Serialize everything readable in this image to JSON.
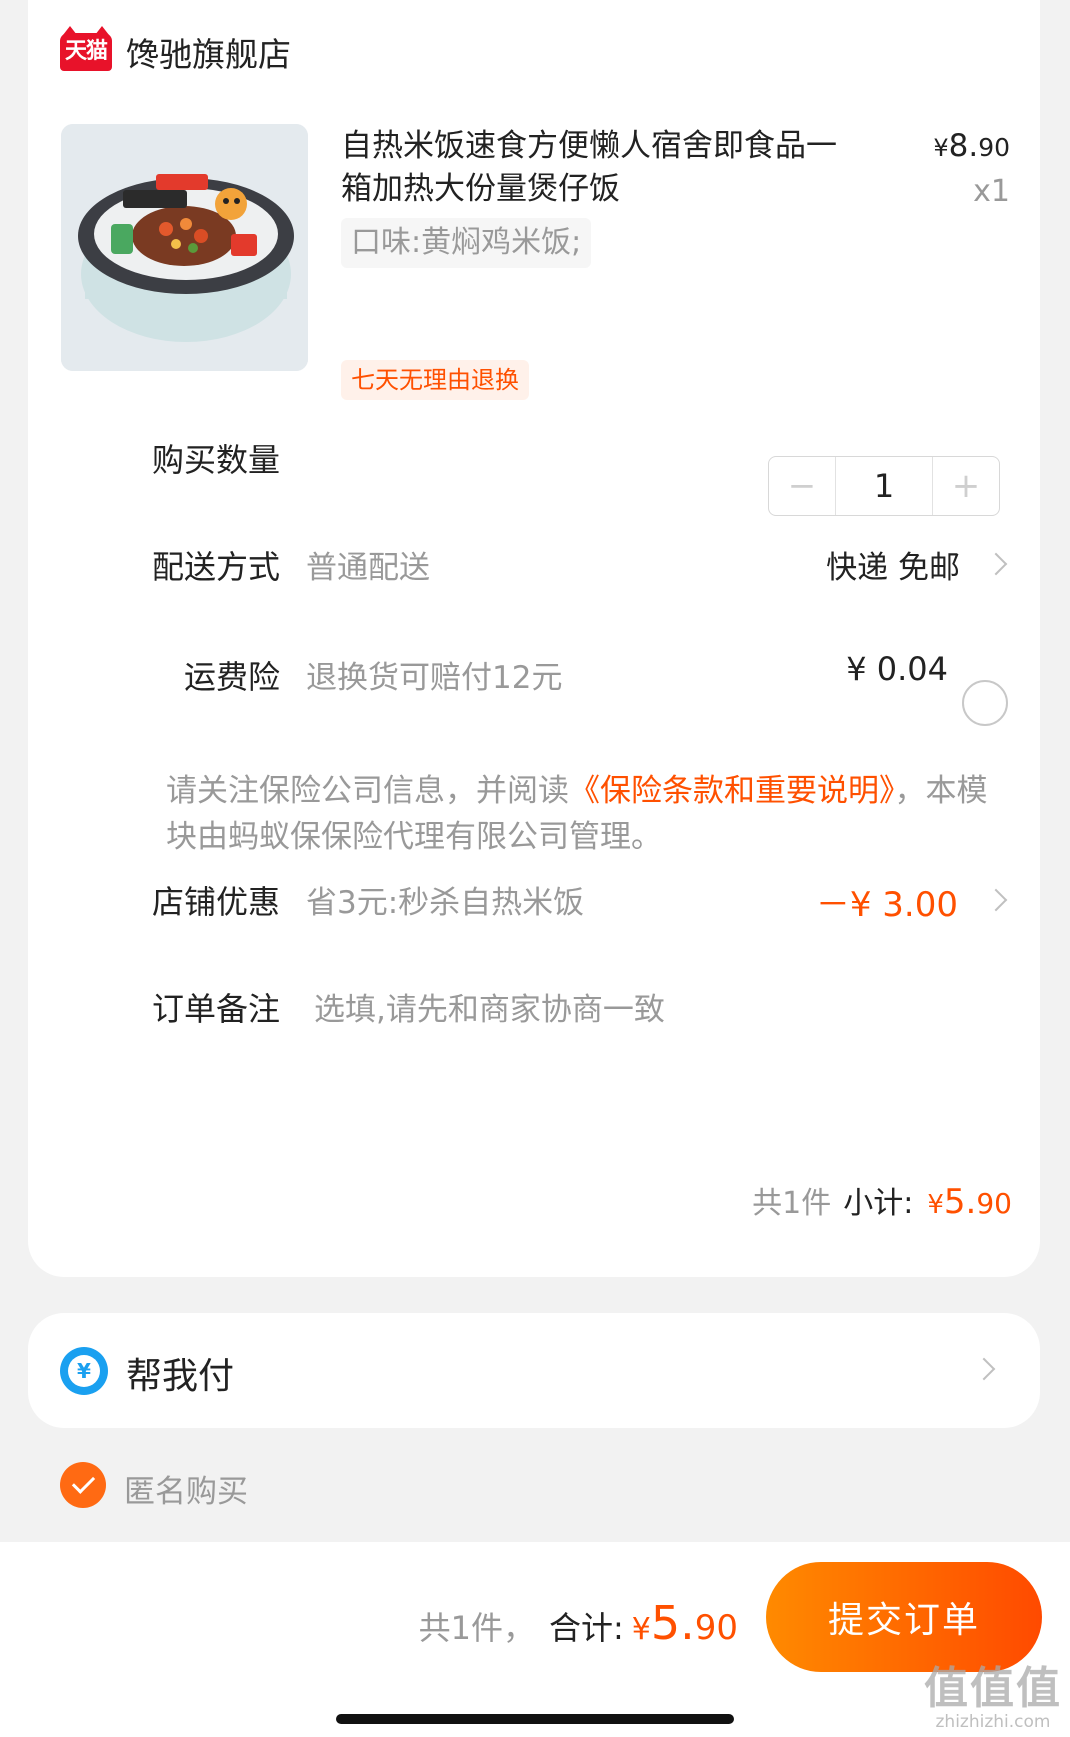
{
  "shop": {
    "badge": "天猫",
    "name": "馋驰旗舰店"
  },
  "product": {
    "title": "自热米饭速食方便懒人宿舍即食品一箱加热大份量煲仔饭",
    "price_currency": "¥",
    "price_integer": "8.",
    "price_decimal": "90",
    "quantity": "x1",
    "sku": "口味:黄焖鸡米饭;",
    "return_policy": "七天无理由退换"
  },
  "quantity_row": {
    "label": "购买数量",
    "minus": "−",
    "value": "1",
    "plus": "+"
  },
  "delivery_row": {
    "label": "配送方式",
    "value": "普通配送",
    "option": "快递 免邮"
  },
  "insurance_row": {
    "label": "运费险",
    "value": "退换货可赔付12元",
    "price": "¥ 0.04",
    "selected": false
  },
  "insurance_note": {
    "prefix": "请关注保险公司信息，并阅读",
    "link": "《保险条款和重要说明》",
    "suffix": "，本模块由蚂蚁保保险代理有限公司管理。"
  },
  "discount_row": {
    "label": "店铺优惠",
    "value": "省3元:秒杀自热米饭",
    "amount": "－¥ 3.00"
  },
  "note_row": {
    "label": "订单备注",
    "placeholder": "选填,请先和商家协商一致"
  },
  "subtotal": {
    "count": "共1件",
    "label": "小计:",
    "currency": "¥",
    "integer": "5.",
    "decimal": "90"
  },
  "pay_for_me": {
    "icon_glyph": "¥",
    "label": "帮我付"
  },
  "anonymous": {
    "label": "匿名购买",
    "checked": true
  },
  "footer": {
    "count": "共1件，",
    "label": "合计:",
    "currency": "¥",
    "integer": "5.",
    "decimal": "90",
    "submit": "提交订单"
  },
  "watermark": {
    "mark": "值值值",
    "url": "zhizhizhi.com"
  },
  "colors": {
    "accent": "#ff5000",
    "tmall_red": "#e8122a",
    "pay_blue": "#1aa0f0"
  }
}
